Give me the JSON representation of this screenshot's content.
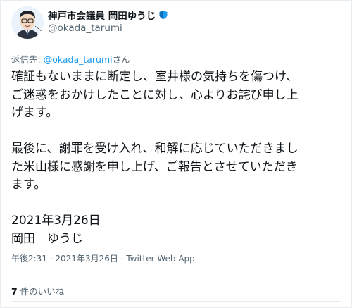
{
  "author": {
    "display_name": "神戸市会議員 岡田ゆうじ",
    "handle": "@okada_tarumi",
    "badge_icon": "shield-icon",
    "badge_color": "#1d9bf0"
  },
  "reply": {
    "prefix": "返信先: ",
    "mention": "@okada_tarumi",
    "suffix": "さん"
  },
  "tweet": {
    "text": "確証もないままに断定し、室井様の気持ちを傷つけ、\nご迷惑をおかけしたことに対し、心よりお詫び申し上\nげます。\n\n最後に、謝罪を受け入れ、和解に応じていただきまし\nた米山様に感謝を申し上げ、ご報告とさせていただき\nます。\n\n2021年3月26日\n岡田　ゆうじ"
  },
  "meta": {
    "time": "午後2:31",
    "separator1": " · ",
    "date": "2021年3月26日",
    "separator2": " · ",
    "app": "Twitter Web App"
  },
  "likes": {
    "count": "7",
    "label": " 件のいいね"
  },
  "colors": {
    "accent": "#1d9bf0",
    "text": "#0f1419",
    "muted": "#536471",
    "border": "#e6ecf0"
  }
}
